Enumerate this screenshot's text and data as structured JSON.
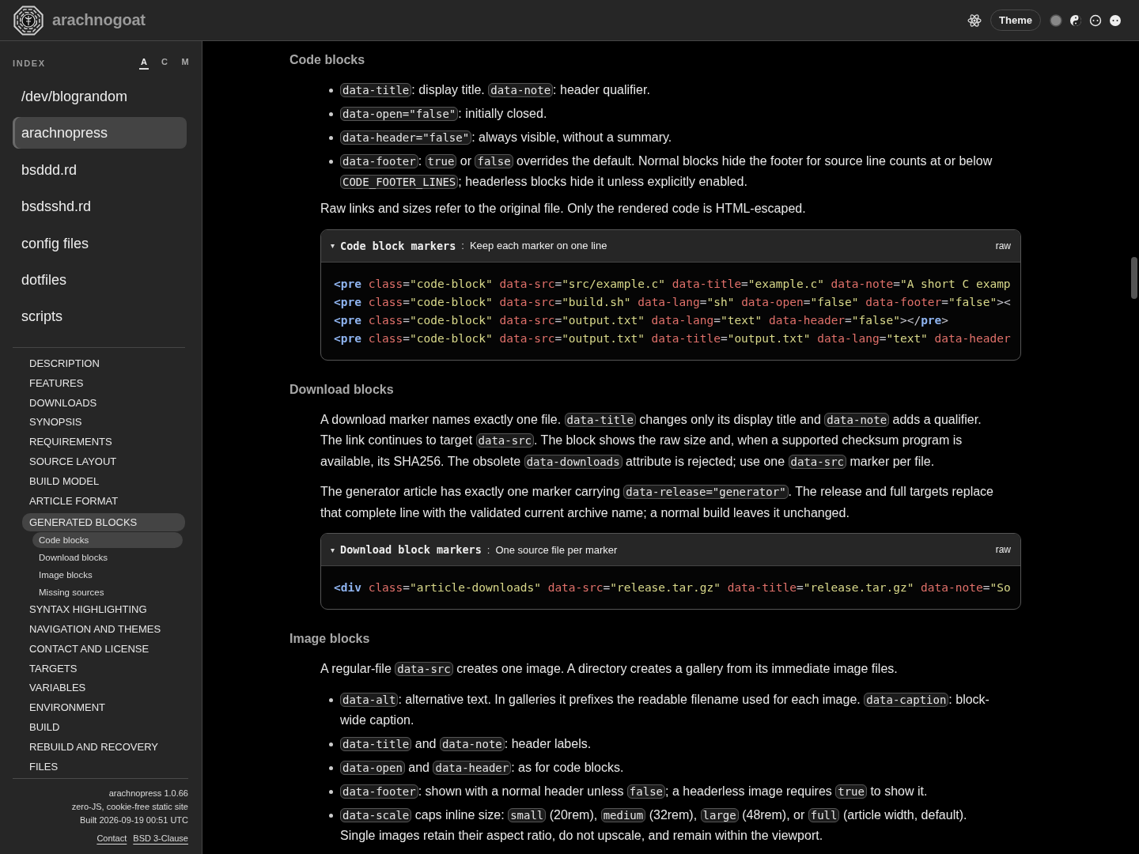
{
  "header": {
    "site_name": "arachnogoat",
    "theme_button": "Theme",
    "theme_options": [
      {
        "kind": "disc"
      },
      {
        "kind": "yinyang"
      },
      {
        "kind": "outline"
      },
      {
        "kind": "solid"
      }
    ]
  },
  "sidebar": {
    "index_label": "INDEX",
    "sort_options": [
      {
        "label": "A",
        "selected": true
      },
      {
        "label": "C",
        "selected": false
      },
      {
        "label": "M",
        "selected": false
      }
    ],
    "projects": [
      {
        "label": "/dev/blograndom",
        "selected": false
      },
      {
        "label": "arachnopress",
        "selected": true
      },
      {
        "label": "bsddd.rd",
        "selected": false
      },
      {
        "label": "bsdsshd.rd",
        "selected": false
      },
      {
        "label": "config files",
        "selected": false
      },
      {
        "label": "dotfiles",
        "selected": false
      },
      {
        "label": "scripts",
        "selected": false
      }
    ],
    "sections": [
      {
        "label": "DESCRIPTION",
        "selected": false
      },
      {
        "label": "FEATURES",
        "selected": false
      },
      {
        "label": "DOWNLOADS",
        "selected": false
      },
      {
        "label": "SYNOPSIS",
        "selected": false
      },
      {
        "label": "REQUIREMENTS",
        "selected": false
      },
      {
        "label": "SOURCE LAYOUT",
        "selected": false
      },
      {
        "label": "BUILD MODEL",
        "selected": false
      },
      {
        "label": "ARTICLE FORMAT",
        "selected": false
      },
      {
        "label": "GENERATED BLOCKS",
        "selected": true,
        "children": [
          {
            "label": "Code blocks",
            "selected": true
          },
          {
            "label": "Download blocks",
            "selected": false
          },
          {
            "label": "Image blocks",
            "selected": false
          },
          {
            "label": "Missing sources",
            "selected": false
          }
        ]
      },
      {
        "label": "SYNTAX HIGHLIGHTING",
        "selected": false
      },
      {
        "label": "NAVIGATION AND THEMES",
        "selected": false
      },
      {
        "label": "CONTACT AND LICENSE",
        "selected": false
      },
      {
        "label": "TARGETS",
        "selected": false
      },
      {
        "label": "VARIABLES",
        "selected": false
      },
      {
        "label": "ENVIRONMENT",
        "selected": false
      },
      {
        "label": "BUILD",
        "selected": false
      },
      {
        "label": "REBUILD AND RECOVERY",
        "selected": false
      },
      {
        "label": "FILES",
        "selected": false
      }
    ],
    "footer": {
      "lines": [
        "arachnopress 1.0.66",
        "zero-JS, cookie-free static site",
        "Built 2026-09-19 00:51 UTC"
      ],
      "links": [
        "Contact",
        "BSD 3-Clause"
      ]
    }
  },
  "article": [
    {
      "heading": "Code blocks",
      "blocks": [
        {
          "kind": "list",
          "items": [
            [
              {
                "code": "data-title"
              },
              {
                "text": ": display title. "
              },
              {
                "code": "data-note"
              },
              {
                "text": ": header qualifier."
              }
            ],
            [
              {
                "code": "data-open=\"false\""
              },
              {
                "text": ": initially closed."
              }
            ],
            [
              {
                "code": "data-header=\"false\""
              },
              {
                "text": ": always visible, without a summary."
              }
            ],
            [
              {
                "code": "data-footer"
              },
              {
                "text": ": "
              },
              {
                "code": "true"
              },
              {
                "text": " or "
              },
              {
                "code": "false"
              },
              {
                "text": " overrides the default. Normal blocks hide the footer for source line counts at or below "
              },
              {
                "code": "CODE_FOOTER_LINES"
              },
              {
                "text": "; headerless blocks hide it unless explicitly enabled."
              }
            ]
          ]
        },
        {
          "kind": "para",
          "parts": [
            {
              "text": "Raw links and sizes refer to the original file. Only the rendered code is HTML-escaped."
            }
          ]
        },
        {
          "kind": "code",
          "toggle": "▾",
          "title": "Code block markers",
          "separator": ":",
          "note": "Keep each marker on one line",
          "action": "raw",
          "lines": [
            [
              {
                "kind": "tag",
                "text": "<pre"
              },
              {
                "kind": "attr",
                "text": " class"
              },
              {
                "kind": "eq",
                "text": "="
              },
              {
                "kind": "str",
                "text": "\"code-block\""
              },
              {
                "kind": "attr",
                "text": " data-src"
              },
              {
                "kind": "eq",
                "text": "="
              },
              {
                "kind": "str",
                "text": "\"src/example.c\""
              },
              {
                "kind": "attr",
                "text": " data-title"
              },
              {
                "kind": "eq",
                "text": "="
              },
              {
                "kind": "str",
                "text": "\"example.c\""
              },
              {
                "kind": "attr",
                "text": " data-note"
              },
              {
                "kind": "eq",
                "text": "="
              },
              {
                "kind": "str",
                "text": "\"A short C examp"
              }
            ],
            [
              {
                "kind": "tag",
                "text": "<pre"
              },
              {
                "kind": "attr",
                "text": " class"
              },
              {
                "kind": "eq",
                "text": "="
              },
              {
                "kind": "str",
                "text": "\"code-block\""
              },
              {
                "kind": "attr",
                "text": " data-src"
              },
              {
                "kind": "eq",
                "text": "="
              },
              {
                "kind": "str",
                "text": "\"build.sh\""
              },
              {
                "kind": "attr",
                "text": " data-lang"
              },
              {
                "kind": "eq",
                "text": "="
              },
              {
                "kind": "str",
                "text": "\"sh\""
              },
              {
                "kind": "attr",
                "text": " data-open"
              },
              {
                "kind": "eq",
                "text": "="
              },
              {
                "kind": "str",
                "text": "\"false\""
              },
              {
                "kind": "attr",
                "text": " data-footer"
              },
              {
                "kind": "eq",
                "text": "="
              },
              {
                "kind": "str",
                "text": "\"false\""
              },
              {
                "kind": "eq",
                "text": "><"
              }
            ],
            [
              {
                "kind": "tag",
                "text": "<pre"
              },
              {
                "kind": "attr",
                "text": " class"
              },
              {
                "kind": "eq",
                "text": "="
              },
              {
                "kind": "str",
                "text": "\"code-block\""
              },
              {
                "kind": "attr",
                "text": " data-src"
              },
              {
                "kind": "eq",
                "text": "="
              },
              {
                "kind": "str",
                "text": "\"output.txt\""
              },
              {
                "kind": "attr",
                "text": " data-lang"
              },
              {
                "kind": "eq",
                "text": "="
              },
              {
                "kind": "str",
                "text": "\"text\""
              },
              {
                "kind": "attr",
                "text": " data-header"
              },
              {
                "kind": "eq",
                "text": "="
              },
              {
                "kind": "str",
                "text": "\"false\""
              },
              {
                "kind": "eq",
                "text": "></"
              },
              {
                "kind": "tag",
                "text": "pre"
              },
              {
                "kind": "eq",
                "text": ">"
              }
            ],
            [
              {
                "kind": "tag",
                "text": "<pre"
              },
              {
                "kind": "attr",
                "text": " class"
              },
              {
                "kind": "eq",
                "text": "="
              },
              {
                "kind": "str",
                "text": "\"code-block\""
              },
              {
                "kind": "attr",
                "text": " data-src"
              },
              {
                "kind": "eq",
                "text": "="
              },
              {
                "kind": "str",
                "text": "\"output.txt\""
              },
              {
                "kind": "attr",
                "text": " data-title"
              },
              {
                "kind": "eq",
                "text": "="
              },
              {
                "kind": "str",
                "text": "\"output.txt\""
              },
              {
                "kind": "attr",
                "text": " data-lang"
              },
              {
                "kind": "eq",
                "text": "="
              },
              {
                "kind": "str",
                "text": "\"text\""
              },
              {
                "kind": "attr",
                "text": " data-header"
              }
            ]
          ]
        }
      ]
    },
    {
      "heading": "Download blocks",
      "blocks": [
        {
          "kind": "para",
          "parts": [
            {
              "text": "A download marker names exactly one file. "
            },
            {
              "code": "data-title"
            },
            {
              "text": " changes only its display title and "
            },
            {
              "code": "data-note"
            },
            {
              "text": " adds a qualifier. The link continues to target "
            },
            {
              "code": "data-src"
            },
            {
              "text": ". The block shows the raw size and, when a supported checksum program is available, its SHA256. The obsolete "
            },
            {
              "code": "data-downloads"
            },
            {
              "text": " attribute is rejected; use one "
            },
            {
              "code": "data-src"
            },
            {
              "text": " marker per file."
            }
          ]
        },
        {
          "kind": "para",
          "parts": [
            {
              "text": "The generator article has exactly one marker carrying "
            },
            {
              "code": "data-release=\"generator\""
            },
            {
              "text": ". The release and full targets replace that complete line with the validated current archive name; a normal build leaves it unchanged."
            }
          ]
        },
        {
          "kind": "code",
          "toggle": "▾",
          "title": "Download block markers",
          "separator": ":",
          "note": "One source file per marker",
          "action": "raw",
          "lines": [
            [
              {
                "kind": "tag",
                "text": "<div"
              },
              {
                "kind": "attr",
                "text": " class"
              },
              {
                "kind": "eq",
                "text": "="
              },
              {
                "kind": "str",
                "text": "\"article-downloads\""
              },
              {
                "kind": "attr",
                "text": " data-src"
              },
              {
                "kind": "eq",
                "text": "="
              },
              {
                "kind": "str",
                "text": "\"release.tar.gz\""
              },
              {
                "kind": "attr",
                "text": " data-title"
              },
              {
                "kind": "eq",
                "text": "="
              },
              {
                "kind": "str",
                "text": "\"release.tar.gz\""
              },
              {
                "kind": "attr",
                "text": " data-note"
              },
              {
                "kind": "eq",
                "text": "="
              },
              {
                "kind": "str",
                "text": "\"So"
              }
            ]
          ]
        }
      ]
    },
    {
      "heading": "Image blocks",
      "blocks": [
        {
          "kind": "para",
          "parts": [
            {
              "text": "A regular-file "
            },
            {
              "code": "data-src"
            },
            {
              "text": " creates one image. A directory creates a gallery from its immediate image files."
            }
          ]
        },
        {
          "kind": "list",
          "items": [
            [
              {
                "code": "data-alt"
              },
              {
                "text": ": alternative text. In galleries it prefixes the readable filename used for each image. "
              },
              {
                "code": "data-caption"
              },
              {
                "text": ": block-wide caption."
              }
            ],
            [
              {
                "code": "data-title"
              },
              {
                "text": " and "
              },
              {
                "code": "data-note"
              },
              {
                "text": ": header labels."
              }
            ],
            [
              {
                "code": "data-open"
              },
              {
                "text": " and "
              },
              {
                "code": "data-header"
              },
              {
                "text": ": as for code blocks."
              }
            ],
            [
              {
                "code": "data-footer"
              },
              {
                "text": ": shown with a normal header unless "
              },
              {
                "code": "false"
              },
              {
                "text": "; a headerless image requires "
              },
              {
                "code": "true"
              },
              {
                "text": " to show it."
              }
            ],
            [
              {
                "code": "data-scale"
              },
              {
                "text": " caps inline size: "
              },
              {
                "code": "small"
              },
              {
                "text": " (20rem), "
              },
              {
                "code": "medium"
              },
              {
                "text": " (32rem), "
              },
              {
                "code": "large"
              },
              {
                "text": " (48rem), or "
              },
              {
                "code": "full"
              },
              {
                "text": " (article width, default). Single images retain their aspect ratio, do not upscale, and remain within the viewport."
              }
            ]
          ]
        }
      ]
    }
  ]
}
